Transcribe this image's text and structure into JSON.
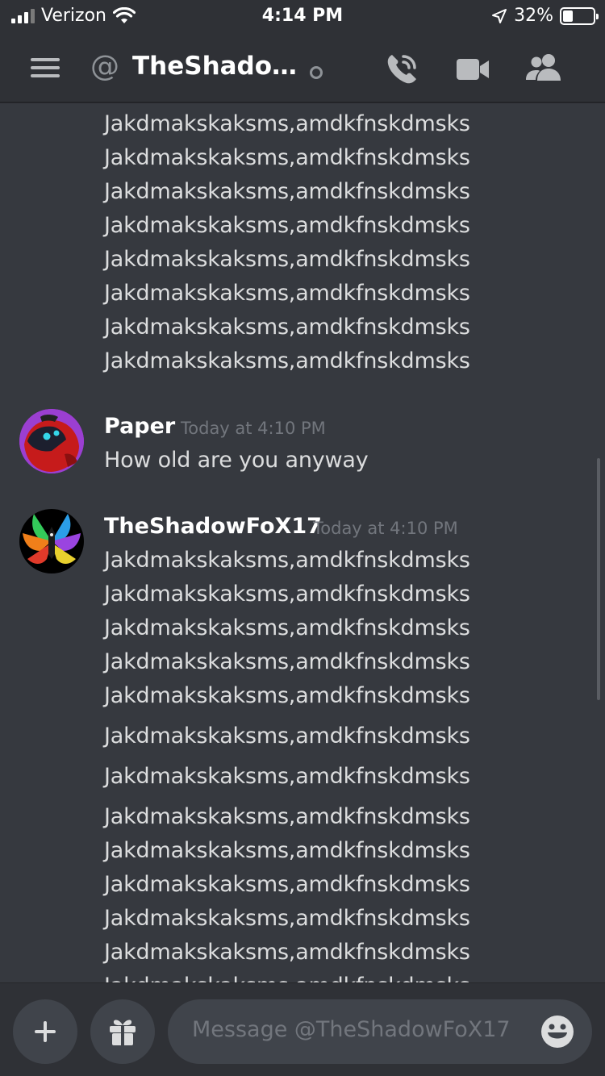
{
  "status_bar": {
    "carrier": "Verizon",
    "time": "4:14 PM",
    "battery": "32%",
    "battery_level": 0.32
  },
  "header": {
    "channel_name": "TheShado…",
    "icons": [
      "menu-icon",
      "at-icon",
      "status-dot",
      "call-icon",
      "video-icon",
      "members-icon"
    ]
  },
  "messages": {
    "top_block": {
      "lines": [
        "Jakdmakskaksms,amdkfnskdmsks",
        "Jakdmakskaksms,amdkfnskdmsks",
        "Jakdmakskaksms,amdkfnskdmsks",
        "Jakdmakskaksms,amdkfnskdmsks",
        "Jakdmakskaksms,amdkfnskdmsks",
        "Jakdmakskaksms,amdkfnskdmsks",
        "Jakdmakskaksms,amdkfnskdmsks",
        "Jakdmakskaksms,amdkfnskdmsks"
      ]
    },
    "paper": {
      "author": "Paper",
      "timestamp": "Today at 4:10 PM",
      "text": "How old are you anyway"
    },
    "shadow": {
      "author": "TheShadowFoX17",
      "timestamp": "Today at 4:10 PM",
      "lines": [
        "Jakdmakskaksms,amdkfnskdmsks",
        "Jakdmakskaksms,amdkfnskdmsks",
        "Jakdmakskaksms,amdkfnskdmsks",
        "Jakdmakskaksms,amdkfnskdmsks",
        "Jakdmakskaksms,amdkfnskdmsks",
        "Jakdmakskaksms,amdkfnskdmsks",
        "Jakdmakskaksms,amdkfnskdmsks",
        "Jakdmakskaksms,amdkfnskdmsks",
        "Jakdmakskaksms,amdkfnskdmsks",
        "Jakdmakskaksms,amdkfnskdmsks",
        "Jakdmakskaksms,amdkfnskdmsks",
        "Jakdmakskaksms,amdkfnskdmsks",
        "Jakdmakskaksms,amdkfnskdmsks"
      ]
    }
  },
  "input": {
    "placeholder": "Message @TheShadowFoX17",
    "icons": [
      "plus-icon",
      "gift-icon",
      "emoji-icon"
    ]
  },
  "colors": {
    "background": "#36393f",
    "header": "#2f3136",
    "input": "#40444b",
    "timestamp": "#72767d"
  }
}
